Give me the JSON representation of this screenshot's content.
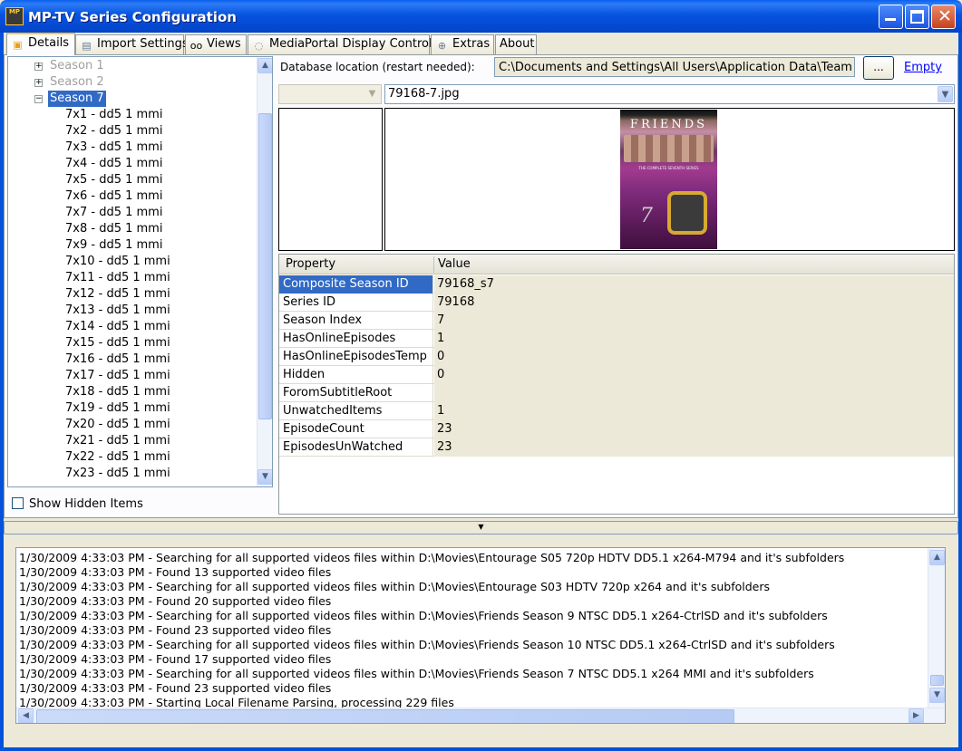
{
  "window": {
    "title": "MP-TV Series Configuration",
    "icon_text": "Media Portal"
  },
  "tabs": [
    {
      "label": "Details",
      "icon": "tv-icon"
    },
    {
      "label": "Import Settings",
      "icon": "import-icon"
    },
    {
      "label": "Views",
      "icon": "glasses-icon"
    },
    {
      "label": "MediaPortal Display Control",
      "icon": "display-icon"
    },
    {
      "label": "Extras",
      "icon": "globe-icon"
    },
    {
      "label": "About",
      "icon": ""
    }
  ],
  "tree": {
    "seasons": [
      "Season 1",
      "Season 2",
      "Season 7"
    ],
    "episodes": [
      "7x1 - dd5 1  mmi",
      "7x2 - dd5 1  mmi",
      "7x3 - dd5 1  mmi",
      "7x4 - dd5 1  mmi",
      "7x5 - dd5 1  mmi",
      "7x6 - dd5 1  mmi",
      "7x7 - dd5 1  mmi",
      "7x8 - dd5 1  mmi",
      "7x9 - dd5 1  mmi",
      "7x10 - dd5 1  mmi",
      "7x11 - dd5 1  mmi",
      "7x12 - dd5 1  mmi",
      "7x13 - dd5 1  mmi",
      "7x14 - dd5 1  mmi",
      "7x15 - dd5 1  mmi",
      "7x16 - dd5 1  mmi",
      "7x17 - dd5 1  mmi",
      "7x18 - dd5 1  mmi",
      "7x19 - dd5 1  mmi",
      "7x20 - dd5 1  mmi",
      "7x21 - dd5 1  mmi",
      "7x22 - dd5 1  mmi",
      "7x23 - dd5 1  mmi"
    ]
  },
  "show_hidden": {
    "label": "Show Hidden Items",
    "checked": false
  },
  "database": {
    "label": "Database location (restart needed):",
    "path": "C:\\Documents and Settings\\All Users\\Application Data\\Team Me",
    "browse_label": "...",
    "empty_label": "Empty"
  },
  "image_combo": {
    "value": "79168-7.jpg"
  },
  "poster": {
    "title": "FRIENDS",
    "subtitle": "THE COMPLETE SEVENTH SERIES",
    "season_num": "7"
  },
  "properties": {
    "header_property": "Property",
    "header_value": "Value",
    "rows": [
      {
        "property": "Composite Season ID",
        "value": "79168_s7"
      },
      {
        "property": "Series ID",
        "value": "79168"
      },
      {
        "property": "Season Index",
        "value": "7"
      },
      {
        "property": "HasOnlineEpisodes",
        "value": "1"
      },
      {
        "property": "HasOnlineEpisodesTemp",
        "value": "0"
      },
      {
        "property": "Hidden",
        "value": "0"
      },
      {
        "property": "ForomSubtitleRoot",
        "value": ""
      },
      {
        "property": "UnwatchedItems",
        "value": "1"
      },
      {
        "property": "EpisodeCount",
        "value": "23"
      },
      {
        "property": "EpisodesUnWatched",
        "value": "23"
      }
    ]
  },
  "log": [
    "1/30/2009 4:33:03 PM - Searching for all supported videos files within D:\\Movies\\Entourage S05 720p HDTV DD5.1 x264-M794 and it's subfolders",
    "1/30/2009 4:33:03 PM - Found 13 supported video files",
    "1/30/2009 4:33:03 PM - Searching for all supported videos files within D:\\Movies\\Entourage S03 HDTV 720p x264 and it's subfolders",
    "1/30/2009 4:33:03 PM - Found 20 supported video files",
    "1/30/2009 4:33:03 PM - Searching for all supported videos files within D:\\Movies\\Friends Season 9 NTSC DD5.1 x264-CtrlSD and it's subfolders",
    "1/30/2009 4:33:03 PM - Found 23 supported video files",
    "1/30/2009 4:33:03 PM - Searching for all supported videos files within D:\\Movies\\Friends Season 10 NTSC DD5.1 x264-CtrlSD and it's subfolders",
    "1/30/2009 4:33:03 PM - Found 17 supported video files",
    "1/30/2009 4:33:03 PM - Searching for all supported videos files within D:\\Movies\\Friends Season 7 NTSC DD5.1 x264 MMI and it's subfolders",
    "1/30/2009 4:33:03 PM - Found 23 supported video files",
    "1/30/2009 4:33:03 PM - Starting Local Filename Parsing, processing 229 files"
  ],
  "colors": {
    "titlebar": "#0454e0",
    "selection": "#316ac5",
    "face": "#ece9d8",
    "link": "#0000ff"
  }
}
